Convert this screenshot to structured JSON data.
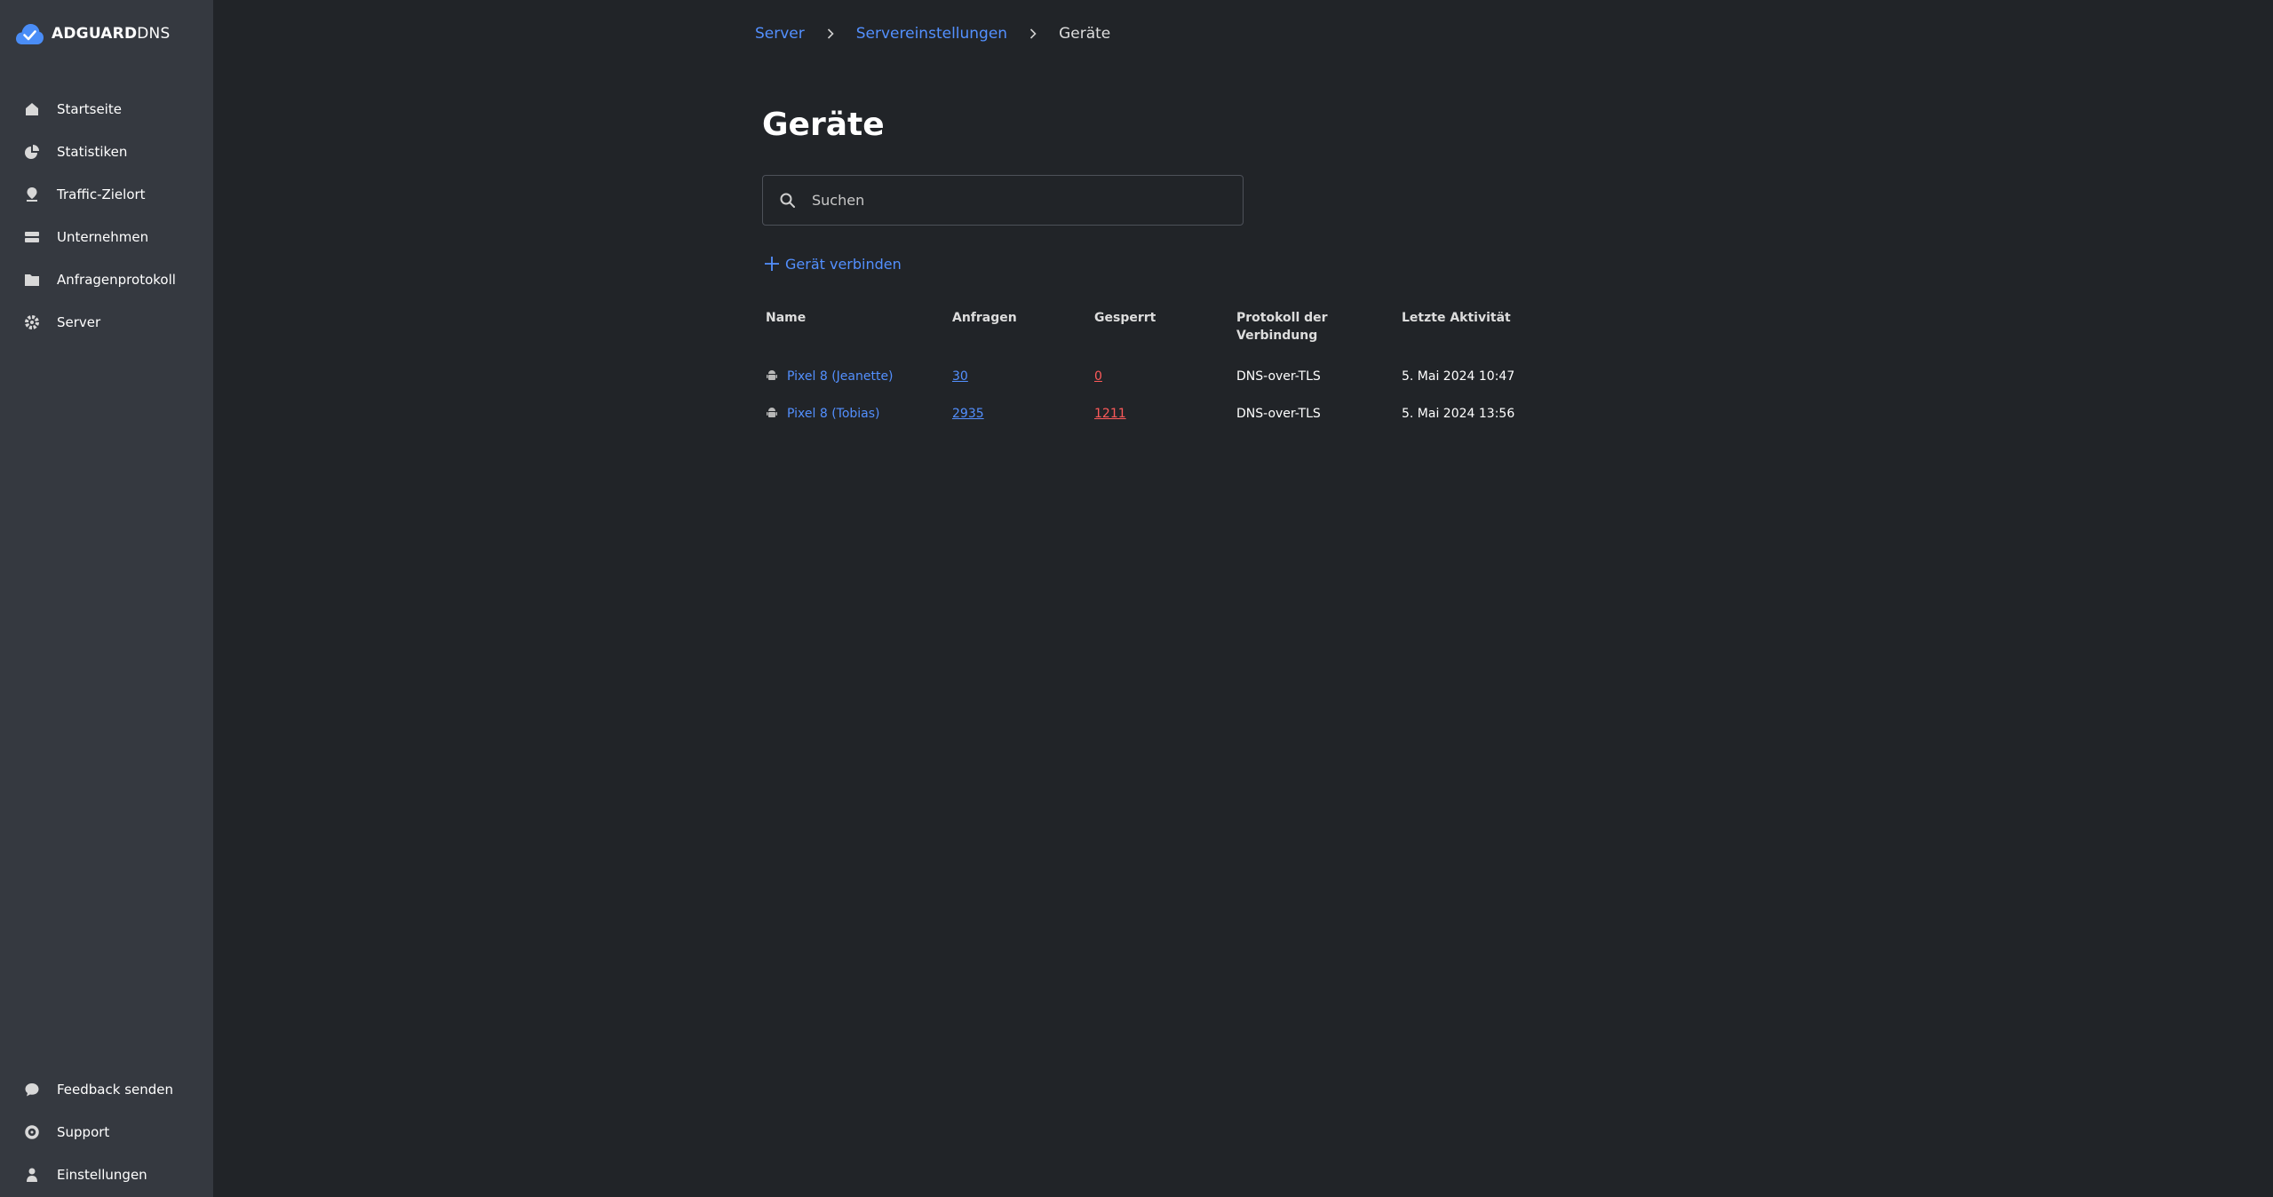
{
  "app": {
    "logo_bold": "ADGUARD",
    "logo_light": "DNS"
  },
  "sidebar": {
    "items": [
      {
        "label": "Startseite",
        "icon": "home-icon"
      },
      {
        "label": "Statistiken",
        "icon": "pie-chart-icon"
      },
      {
        "label": "Traffic-Zielort",
        "icon": "location-pin-icon"
      },
      {
        "label": "Unternehmen",
        "icon": "company-icon"
      },
      {
        "label": "Anfragenprotokoll",
        "icon": "folder-icon"
      },
      {
        "label": "Server",
        "icon": "gear-icon"
      }
    ],
    "bottom_items": [
      {
        "label": "Feedback senden",
        "icon": "chat-bubble-icon"
      },
      {
        "label": "Support",
        "icon": "support-icon"
      },
      {
        "label": "Einstellungen",
        "icon": "user-icon"
      }
    ]
  },
  "breadcrumb": {
    "items": [
      "Server",
      "Servereinstellungen"
    ],
    "current": "Geräte"
  },
  "page": {
    "title": "Geräte"
  },
  "search": {
    "placeholder": "Suchen",
    "value": ""
  },
  "actions": {
    "connect_label": "Gerät verbinden"
  },
  "table": {
    "headers": {
      "name": "Name",
      "requests": "Anfragen",
      "blocked": "Gesperrt",
      "protocol_line1": "Protokoll der",
      "protocol_line2": "Verbindung",
      "last_activity": "Letzte Aktivität"
    },
    "rows": [
      {
        "name": "Pixel 8 (Jeanette)",
        "requests": "30",
        "blocked": "0",
        "protocol": "DNS-over-TLS",
        "last_activity": "5. Mai 2024 10:47"
      },
      {
        "name": "Pixel 8 (Tobias)",
        "requests": "2935",
        "blocked": "1211",
        "protocol": "DNS-over-TLS",
        "last_activity": "5. Mai 2024 13:56"
      }
    ]
  },
  "colors": {
    "background": "#212428",
    "sidebar": "#353940",
    "link": "#5390ff",
    "blocked": "#ff5a5a",
    "logo": "#4a8df7"
  }
}
